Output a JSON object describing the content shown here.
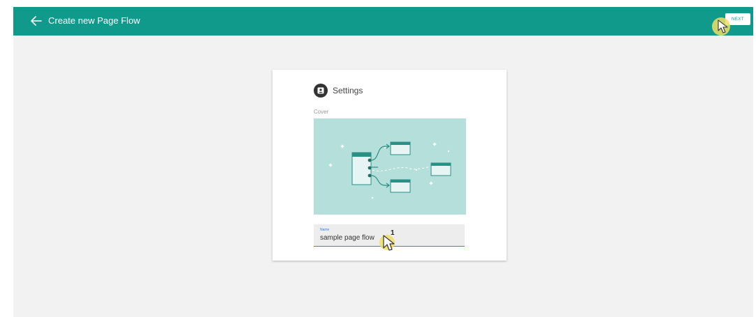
{
  "header": {
    "back_icon": "arrow-left-icon",
    "title": "Create new Page Flow",
    "next_label": "NEXT"
  },
  "card": {
    "settings_icon": "profile-badge-icon",
    "settings_title": "Settings",
    "cover_label": "Cover",
    "cover_image": "page-flow-illustration",
    "name_field": {
      "label": "Name",
      "value": "sample page flow"
    }
  },
  "overlay": {
    "click_step": "1",
    "pointer_icon": "mouse-pointer-icon"
  },
  "colors": {
    "header_bg": "#0f9a8c",
    "page_bg": "#f2f2f2",
    "cover_bg": "#b4dfdb",
    "accent_blue": "#3b7fd4",
    "highlight_yellow": "#eede64"
  }
}
